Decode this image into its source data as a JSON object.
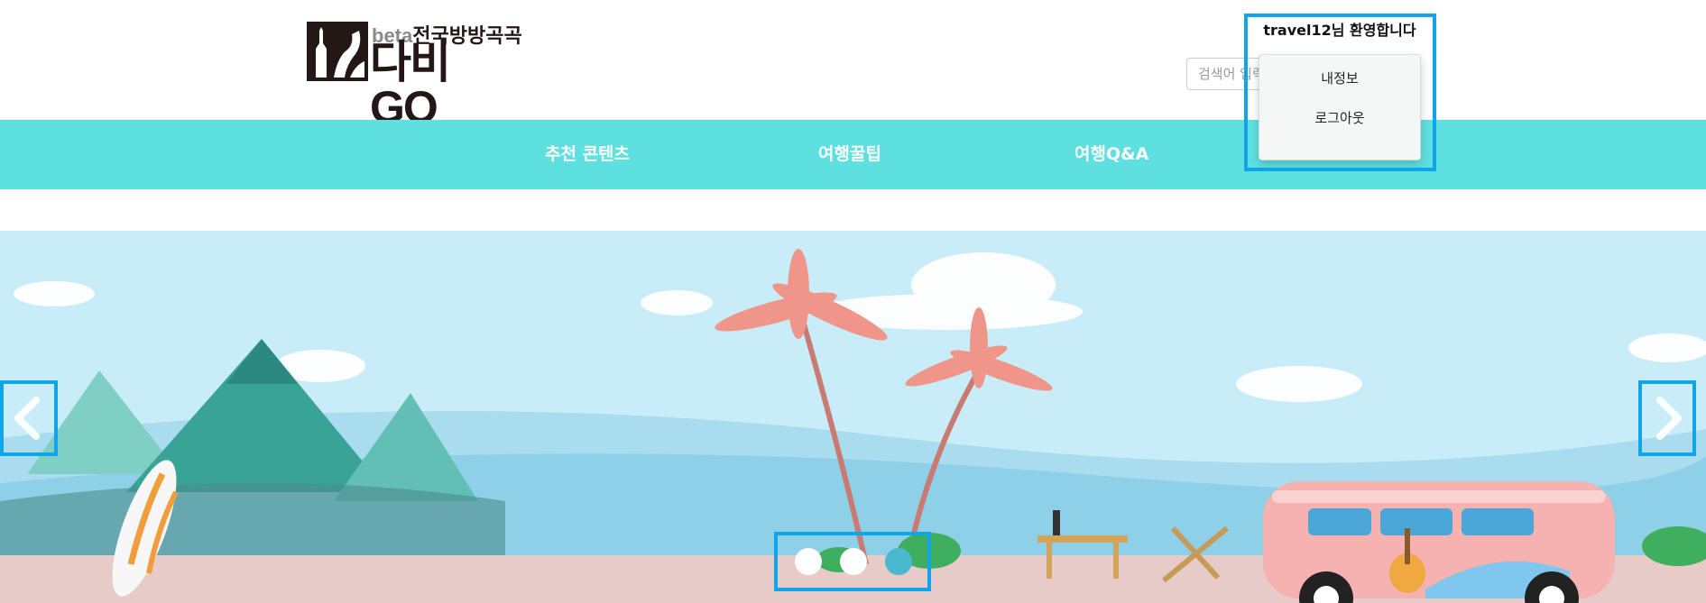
{
  "header": {
    "logo": {
      "beta_label": "beta",
      "tagline": "전국방방곡곡",
      "brand": "다비GO"
    },
    "welcome_user": "travel12",
    "welcome_suffix": "님 환영합니다",
    "search": {
      "placeholder": "검색어 입력"
    }
  },
  "user_menu": {
    "items": [
      {
        "label": "내정보"
      },
      {
        "label": "로그아웃"
      }
    ]
  },
  "nav": {
    "items": [
      {
        "label": "추천 콘텐츠"
      },
      {
        "label": "여행꿀팁"
      },
      {
        "label": "여행Q&A"
      }
    ]
  },
  "carousel": {
    "slide_count": 3,
    "active_index": 2,
    "prev_icon": "chevron-left-icon",
    "next_icon": "chevron-right-icon",
    "colors": {
      "dot_inactive": "#ffffff",
      "dot_active": "#4ab8cf"
    }
  },
  "theme": {
    "nav_bg": "#5ee0e0",
    "highlight": "#12a4e8",
    "brand_dark": "#231815"
  }
}
